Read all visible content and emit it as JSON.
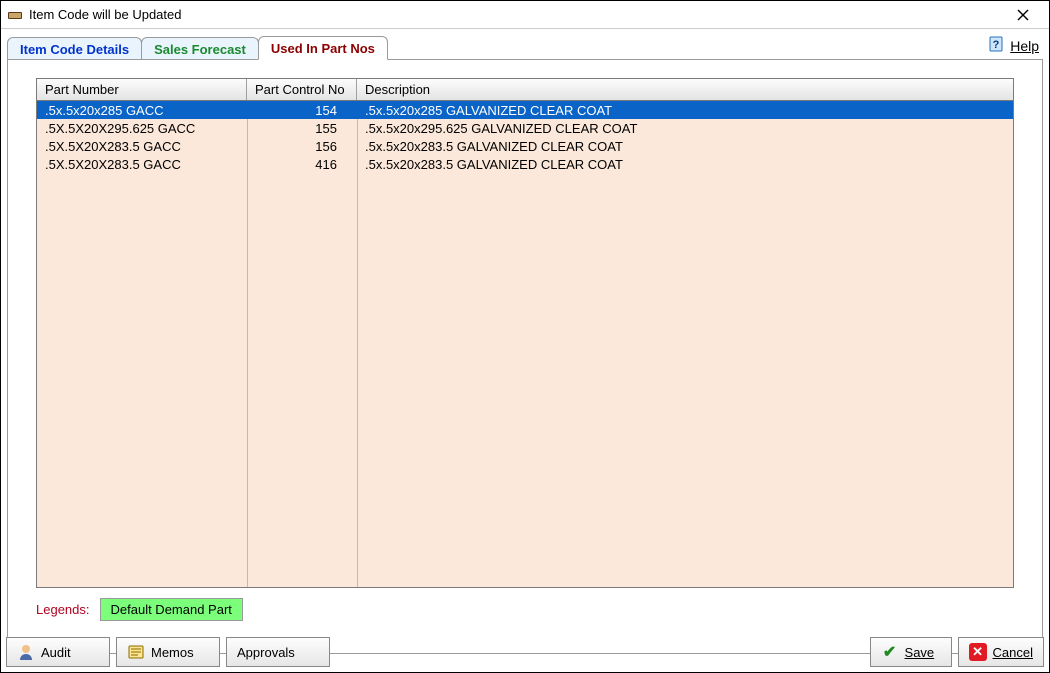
{
  "window": {
    "title": "Item Code will be Updated"
  },
  "help": {
    "label": "Help"
  },
  "tabs": [
    {
      "label": "Item Code Details"
    },
    {
      "label": "Sales Forecast"
    },
    {
      "label": "Used In Part Nos"
    }
  ],
  "grid": {
    "headers": {
      "c1": "Part Number",
      "c2": "Part Control No",
      "c3": "Description"
    },
    "rows": [
      {
        "part": ".5x.5x20x285 GACC",
        "ctrl": "154",
        "desc": ".5x.5x20x285 GALVANIZED CLEAR COAT",
        "selected": true
      },
      {
        "part": ".5X.5X20X295.625 GACC",
        "ctrl": "155",
        "desc": ".5x.5x20x295.625 GALVANIZED CLEAR COAT",
        "selected": false
      },
      {
        "part": ".5X.5X20X283.5 GACC",
        "ctrl": "156",
        "desc": ".5x.5x20x283.5 GALVANIZED CLEAR COAT",
        "selected": false
      },
      {
        "part": ".5X.5X20X283.5 GACC",
        "ctrl": "416",
        "desc": ".5x.5x20x283.5 GALVANIZED CLEAR COAT",
        "selected": false
      }
    ]
  },
  "legends": {
    "label": "Legends:",
    "default_demand": "Default Demand Part"
  },
  "footer": {
    "audit": "Audit",
    "memos": "Memos",
    "approvals": "Approvals",
    "save": "Save",
    "cancel": "Cancel"
  }
}
